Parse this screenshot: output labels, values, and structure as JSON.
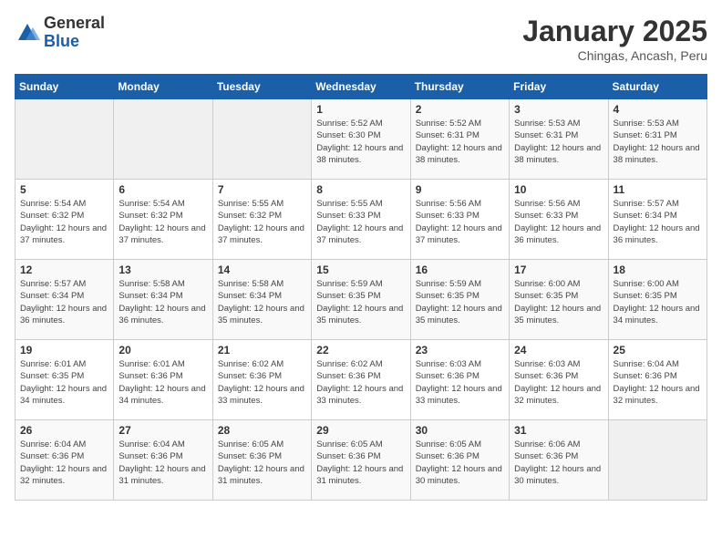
{
  "logo": {
    "general": "General",
    "blue": "Blue"
  },
  "header": {
    "title": "January 2025",
    "subtitle": "Chingas, Ancash, Peru"
  },
  "weekdays": [
    "Sunday",
    "Monday",
    "Tuesday",
    "Wednesday",
    "Thursday",
    "Friday",
    "Saturday"
  ],
  "weeks": [
    [
      {
        "day": "",
        "info": ""
      },
      {
        "day": "",
        "info": ""
      },
      {
        "day": "",
        "info": ""
      },
      {
        "day": "1",
        "info": "Sunrise: 5:52 AM\nSunset: 6:30 PM\nDaylight: 12 hours\nand 38 minutes."
      },
      {
        "day": "2",
        "info": "Sunrise: 5:52 AM\nSunset: 6:31 PM\nDaylight: 12 hours\nand 38 minutes."
      },
      {
        "day": "3",
        "info": "Sunrise: 5:53 AM\nSunset: 6:31 PM\nDaylight: 12 hours\nand 38 minutes."
      },
      {
        "day": "4",
        "info": "Sunrise: 5:53 AM\nSunset: 6:31 PM\nDaylight: 12 hours\nand 38 minutes."
      }
    ],
    [
      {
        "day": "5",
        "info": "Sunrise: 5:54 AM\nSunset: 6:32 PM\nDaylight: 12 hours\nand 37 minutes."
      },
      {
        "day": "6",
        "info": "Sunrise: 5:54 AM\nSunset: 6:32 PM\nDaylight: 12 hours\nand 37 minutes."
      },
      {
        "day": "7",
        "info": "Sunrise: 5:55 AM\nSunset: 6:32 PM\nDaylight: 12 hours\nand 37 minutes."
      },
      {
        "day": "8",
        "info": "Sunrise: 5:55 AM\nSunset: 6:33 PM\nDaylight: 12 hours\nand 37 minutes."
      },
      {
        "day": "9",
        "info": "Sunrise: 5:56 AM\nSunset: 6:33 PM\nDaylight: 12 hours\nand 37 minutes."
      },
      {
        "day": "10",
        "info": "Sunrise: 5:56 AM\nSunset: 6:33 PM\nDaylight: 12 hours\nand 36 minutes."
      },
      {
        "day": "11",
        "info": "Sunrise: 5:57 AM\nSunset: 6:34 PM\nDaylight: 12 hours\nand 36 minutes."
      }
    ],
    [
      {
        "day": "12",
        "info": "Sunrise: 5:57 AM\nSunset: 6:34 PM\nDaylight: 12 hours\nand 36 minutes."
      },
      {
        "day": "13",
        "info": "Sunrise: 5:58 AM\nSunset: 6:34 PM\nDaylight: 12 hours\nand 36 minutes."
      },
      {
        "day": "14",
        "info": "Sunrise: 5:58 AM\nSunset: 6:34 PM\nDaylight: 12 hours\nand 35 minutes."
      },
      {
        "day": "15",
        "info": "Sunrise: 5:59 AM\nSunset: 6:35 PM\nDaylight: 12 hours\nand 35 minutes."
      },
      {
        "day": "16",
        "info": "Sunrise: 5:59 AM\nSunset: 6:35 PM\nDaylight: 12 hours\nand 35 minutes."
      },
      {
        "day": "17",
        "info": "Sunrise: 6:00 AM\nSunset: 6:35 PM\nDaylight: 12 hours\nand 35 minutes."
      },
      {
        "day": "18",
        "info": "Sunrise: 6:00 AM\nSunset: 6:35 PM\nDaylight: 12 hours\nand 34 minutes."
      }
    ],
    [
      {
        "day": "19",
        "info": "Sunrise: 6:01 AM\nSunset: 6:35 PM\nDaylight: 12 hours\nand 34 minutes."
      },
      {
        "day": "20",
        "info": "Sunrise: 6:01 AM\nSunset: 6:36 PM\nDaylight: 12 hours\nand 34 minutes."
      },
      {
        "day": "21",
        "info": "Sunrise: 6:02 AM\nSunset: 6:36 PM\nDaylight: 12 hours\nand 33 minutes."
      },
      {
        "day": "22",
        "info": "Sunrise: 6:02 AM\nSunset: 6:36 PM\nDaylight: 12 hours\nand 33 minutes."
      },
      {
        "day": "23",
        "info": "Sunrise: 6:03 AM\nSunset: 6:36 PM\nDaylight: 12 hours\nand 33 minutes."
      },
      {
        "day": "24",
        "info": "Sunrise: 6:03 AM\nSunset: 6:36 PM\nDaylight: 12 hours\nand 32 minutes."
      },
      {
        "day": "25",
        "info": "Sunrise: 6:04 AM\nSunset: 6:36 PM\nDaylight: 12 hours\nand 32 minutes."
      }
    ],
    [
      {
        "day": "26",
        "info": "Sunrise: 6:04 AM\nSunset: 6:36 PM\nDaylight: 12 hours\nand 32 minutes."
      },
      {
        "day": "27",
        "info": "Sunrise: 6:04 AM\nSunset: 6:36 PM\nDaylight: 12 hours\nand 31 minutes."
      },
      {
        "day": "28",
        "info": "Sunrise: 6:05 AM\nSunset: 6:36 PM\nDaylight: 12 hours\nand 31 minutes."
      },
      {
        "day": "29",
        "info": "Sunrise: 6:05 AM\nSunset: 6:36 PM\nDaylight: 12 hours\nand 31 minutes."
      },
      {
        "day": "30",
        "info": "Sunrise: 6:05 AM\nSunset: 6:36 PM\nDaylight: 12 hours\nand 30 minutes."
      },
      {
        "day": "31",
        "info": "Sunrise: 6:06 AM\nSunset: 6:36 PM\nDaylight: 12 hours\nand 30 minutes."
      },
      {
        "day": "",
        "info": ""
      }
    ]
  ]
}
